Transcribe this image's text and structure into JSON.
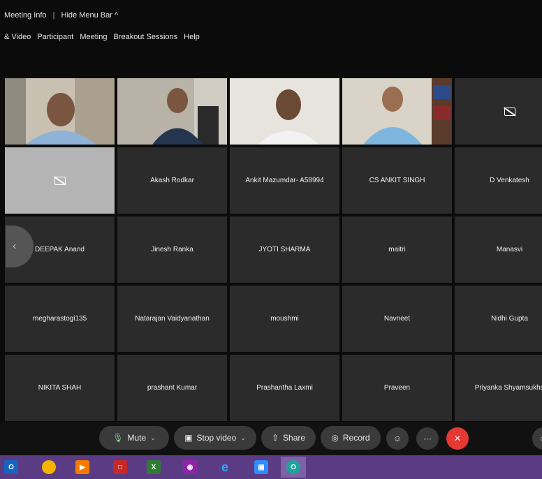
{
  "topbar": {
    "meeting_info": "Meeting Info",
    "separator": "|",
    "hide_menu_bar": "Hide Menu Bar ^",
    "menu": [
      "& Video",
      "Participant",
      "Meeting",
      "Breakout Sessions",
      "Help"
    ]
  },
  "grid": {
    "row1": [
      "",
      "",
      "",
      "",
      ""
    ],
    "row2": [
      "",
      "Akash Rodkar",
      "Ankit Mazumdar- A58994",
      "CS ANKIT SINGH",
      "D Venkatesh"
    ],
    "row3": [
      "DEEPAK Anand",
      "Jinesh Ranka",
      "JYOTI SHARMA",
      "maitri",
      "Manasvi"
    ],
    "row4": [
      "megharastogi135",
      "Natarajan Vaidyanathan",
      "moushmi",
      "Navneet",
      "Nidhi Gupta"
    ],
    "row5": [
      "NIKITA SHAH",
      "prashant Kumar",
      "Prashantha Laxmi",
      "Praveen",
      "Priyanka Shyamsukha"
    ]
  },
  "controls": {
    "mute": "Mute",
    "stop_video": "Stop video",
    "share": "Share",
    "record": "Record",
    "more": "···"
  },
  "icons": {
    "nav_prev": "chevron-left-icon",
    "mic": "microphone-icon",
    "camera": "camera-icon",
    "share": "share-icon",
    "record": "record-icon",
    "reactions": "smiley-icon",
    "end": "close-icon"
  },
  "colors": {
    "end_button": "#e53935",
    "taskbar": "#5b3c84",
    "tile": "#2b2b2b"
  }
}
